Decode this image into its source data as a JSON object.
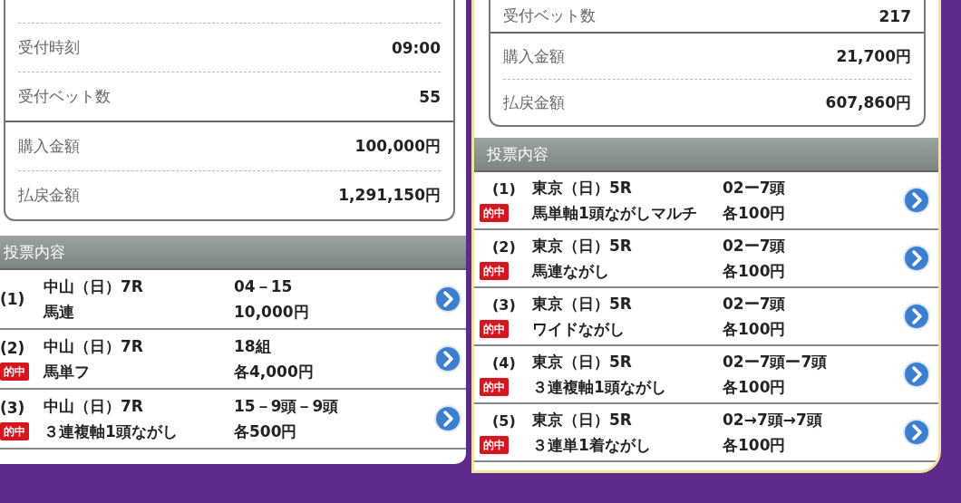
{
  "panels": [
    {
      "summary": [
        [
          {
            "label": "受付時刻",
            "value": "09:00"
          },
          {
            "label": "受付ベット数",
            "value": "55"
          }
        ],
        [
          {
            "label": "購入金額",
            "value": "100,000円"
          },
          {
            "label": "払戻金額",
            "value": "1,291,150円"
          }
        ]
      ],
      "section_title": "投票内容",
      "bets": [
        {
          "number": "(1)",
          "race": "中山（日）7R",
          "type": "馬連",
          "combination": "04－15",
          "amount": "10,000円"
        },
        {
          "number": "(2)",
          "badge": "的中",
          "race": "中山（日）7R",
          "type": "馬単フ",
          "combination": "18組",
          "amount": "各4,000円"
        },
        {
          "number": "(3)",
          "badge": "的中",
          "race": "中山（日）7R",
          "type": "３連複軸1頭ながし",
          "combination": "15－9頭－9頭",
          "amount": "各500円"
        }
      ]
    },
    {
      "summary": [
        [
          {
            "label": "受付ベット数",
            "value": "217"
          }
        ],
        [
          {
            "label": "購入金額",
            "value": "21,700円"
          },
          {
            "label": "払戻金額",
            "value": "607,860円"
          }
        ]
      ],
      "section_title": "投票内容",
      "bets": [
        {
          "number": "(1)",
          "badge": "的中",
          "race": "東京（日）5R",
          "type": "馬単軸1頭ながしマルチ",
          "combination": "02ー7頭",
          "amount": "各100円"
        },
        {
          "number": "(2)",
          "badge": "的中",
          "race": "東京（日）5R",
          "type": "馬連ながし",
          "combination": "02ー7頭",
          "amount": "各100円"
        },
        {
          "number": "(3)",
          "badge": "的中",
          "race": "東京（日）5R",
          "type": "ワイドながし",
          "combination": "02ー7頭",
          "amount": "各100円"
        },
        {
          "number": "(4)",
          "badge": "的中",
          "race": "東京（日）5R",
          "type": "３連複軸1頭ながし",
          "combination": "02ー7頭ー7頭",
          "amount": "各100円"
        },
        {
          "number": "(5)",
          "badge": "的中",
          "race": "東京（日）5R",
          "type": "３連単1着ながし",
          "combination": "02→7頭→7頭",
          "amount": "各100円"
        }
      ]
    }
  ]
}
